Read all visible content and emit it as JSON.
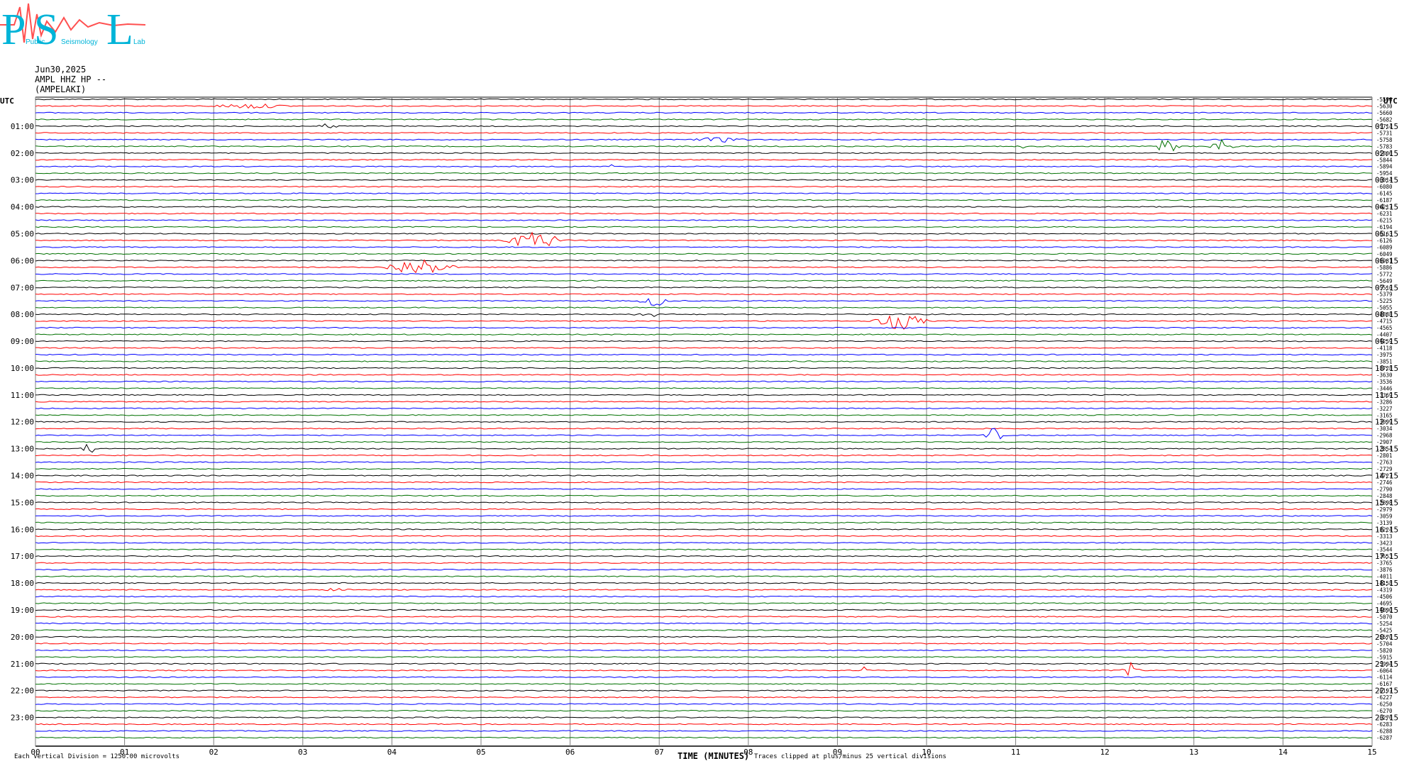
{
  "logo": {
    "letters": [
      "P",
      "S",
      "L"
    ],
    "small_words": [
      "Public",
      "Seismology",
      "Lab"
    ]
  },
  "header": {
    "date": "Jun30,2025",
    "station": "AMPL HHZ HP --",
    "site": "(AMPELAKI)"
  },
  "colors": {
    "cycle": [
      "#000000",
      "#ff0000",
      "#0000ff",
      "#007000"
    ],
    "grid": "#808080",
    "logo_text": "#00b4d8",
    "logo_wave": "#ff5050"
  },
  "chart_data": {
    "type": "line",
    "title": "",
    "xlabel": "TIME (MINUTES)",
    "ylabel": "",
    "xlim": [
      0,
      15
    ],
    "x_ticks": [
      "00",
      "01",
      "02",
      "03",
      "04",
      "05",
      "06",
      "07",
      "08",
      "09",
      "10",
      "11",
      "12",
      "13",
      "14",
      "15"
    ],
    "left_axis_title": "UTC",
    "right_axis_title": "UTC",
    "left_time_labels": [
      "01:00",
      "02:00",
      "03:00",
      "04:00",
      "05:00",
      "06:00",
      "07:00",
      "08:00",
      "09:00",
      "10:00",
      "11:00",
      "12:00",
      "13:00",
      "14:00",
      "15:00",
      "16:00",
      "17:00",
      "18:00",
      "19:00",
      "20:00",
      "21:00",
      "22:00",
      "23:00"
    ],
    "right_time_labels": [
      "01:15",
      "02:15",
      "03:15",
      "04:15",
      "05:15",
      "06:15",
      "07:15",
      "08:15",
      "09:15",
      "10:15",
      "11:15",
      "12:15",
      "13:15",
      "14:15",
      "15:15",
      "16:15",
      "17:15",
      "18:15",
      "19:15",
      "20:15",
      "21:15",
      "22:15",
      "23:15"
    ],
    "trace_count": 96,
    "trace_offsets": [
      "-5596",
      "-5630",
      "-5660",
      "-5682",
      "-5714",
      "-5731",
      "-5758",
      "-5783",
      "-5806",
      "-5844",
      "-5894",
      "-5954",
      "-6014",
      "-6080",
      "-6145",
      "-6187",
      "-6217",
      "-6231",
      "-6215",
      "-6194",
      "-6163",
      "-6126",
      "-6089",
      "-6049",
      "-5981",
      "-5886",
      "-5772",
      "-5649",
      "-5510",
      "-5379",
      "-5225",
      "-5055",
      "-4888",
      "-4715",
      "-4565",
      "-4407",
      "-4259",
      "-4118",
      "-3975",
      "-3851",
      "-3728",
      "-3630",
      "-3536",
      "-3446",
      "-3369",
      "-3286",
      "-3227",
      "-3165",
      "-3099",
      "-3034",
      "-2968",
      "-2907",
      "-2854",
      "-2801",
      "-2763",
      "-2729",
      "-2727",
      "-2746",
      "-2790",
      "-2848",
      "-2898",
      "-2979",
      "-3059",
      "-3139",
      "-3224",
      "-3313",
      "-3423",
      "-3544",
      "-3653",
      "-3765",
      "-3876",
      "-4011",
      "-4158",
      "-4319",
      "-4506",
      "-4695",
      "-4890",
      "-5070",
      "-5254",
      "-5425",
      "-5570",
      "-5704",
      "-5820",
      "-5915",
      "-5994",
      "-6064",
      "-6114",
      "-6167",
      "-6197",
      "-6227",
      "-6250",
      "-6270",
      "-6276",
      "-6283",
      "-6288",
      "-6287"
    ],
    "events": [
      {
        "trace": 1,
        "minute": 2.4,
        "width": 1.0,
        "amp": 0.3
      },
      {
        "trace": 4,
        "minute": 3.3,
        "width": 0.3,
        "amp": 0.35
      },
      {
        "trace": 6,
        "minute": 7.7,
        "width": 0.7,
        "amp": 0.3
      },
      {
        "trace": 7,
        "minute": 12.7,
        "width": 0.3,
        "amp": 1.1
      },
      {
        "trace": 7,
        "minute": 13.3,
        "width": 0.35,
        "amp": 0.9
      },
      {
        "trace": 7,
        "minute": 11.1,
        "width": 0.1,
        "amp": 0.3
      },
      {
        "trace": 10,
        "minute": 6.45,
        "width": 0.05,
        "amp": 0.6
      },
      {
        "trace": 21,
        "minute": 5.6,
        "width": 0.8,
        "amp": 1.1
      },
      {
        "trace": 25,
        "minute": 4.3,
        "width": 0.9,
        "amp": 1.2
      },
      {
        "trace": 30,
        "minute": 6.95,
        "width": 0.4,
        "amp": 0.7
      },
      {
        "trace": 32,
        "minute": 6.9,
        "width": 0.4,
        "amp": 0.3
      },
      {
        "trace": 33,
        "minute": 9.7,
        "width": 0.7,
        "amp": 1.1
      },
      {
        "trace": 50,
        "minute": 10.75,
        "width": 0.3,
        "amp": 0.9
      },
      {
        "trace": 52,
        "minute": 0.6,
        "width": 0.2,
        "amp": 0.8
      },
      {
        "trace": 73,
        "minute": 3.4,
        "width": 0.3,
        "amp": 0.3
      },
      {
        "trace": 85,
        "minute": 12.3,
        "width": 0.25,
        "amp": 1.0
      },
      {
        "trace": 85,
        "minute": 9.3,
        "width": 0.15,
        "amp": 0.4
      }
    ]
  },
  "footer": {
    "scale_note": "Each Vertical Division = 1250.00 microvolts",
    "clip_note": "Traces clipped at plus/minus 25 vertical divisions"
  }
}
